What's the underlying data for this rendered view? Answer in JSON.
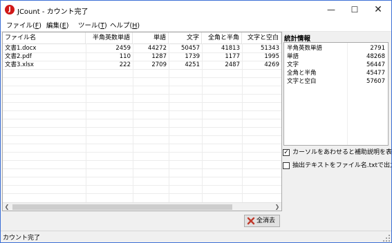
{
  "window": {
    "title": "JCount - カウント完了",
    "icon_letter": "J"
  },
  "menu": [
    {
      "label": "ファイル(",
      "key": "F",
      "suffix": ")"
    },
    {
      "label": "編集(",
      "key": "E",
      "suffix": ")"
    },
    {
      "label": "ツール(",
      "key": "T",
      "suffix": ")"
    },
    {
      "label": "ヘルプ(",
      "key": "H",
      "suffix": ")"
    }
  ],
  "list": {
    "columns": [
      "ファイル名",
      "半角英数単語",
      "単語",
      "文字",
      "全角と半角",
      "文字と空白"
    ],
    "rows": [
      [
        "文書1.docx",
        "2459",
        "44272",
        "50457",
        "41813",
        "51343"
      ],
      [
        "文書2.pdf",
        "110",
        "1287",
        "1739",
        "1177",
        "1995"
      ],
      [
        "文書3.xlsx",
        "222",
        "2709",
        "4251",
        "2487",
        "4269"
      ]
    ]
  },
  "stats": {
    "title": "統計情報",
    "rows": [
      {
        "label": "半角英数単語",
        "value": "2791"
      },
      {
        "label": "単語",
        "value": "48268"
      },
      {
        "label": "文字",
        "value": "56447"
      },
      {
        "label": "全角と半角",
        "value": "45477"
      },
      {
        "label": "文字と空白",
        "value": "57607"
      }
    ]
  },
  "options": {
    "tooltip_label": "カーソルをあわせると補助説明を表示",
    "tooltip_checked": true,
    "export_label": "抽出テキストをファイル名.txtで出力",
    "export_checked": false
  },
  "clear_button": {
    "label": "全消去"
  },
  "status": {
    "text": "カウント完了"
  },
  "colors": {
    "app_icon": "#d01818",
    "window_border": "#3c6fd6",
    "clear_icon": "#c0392b"
  }
}
